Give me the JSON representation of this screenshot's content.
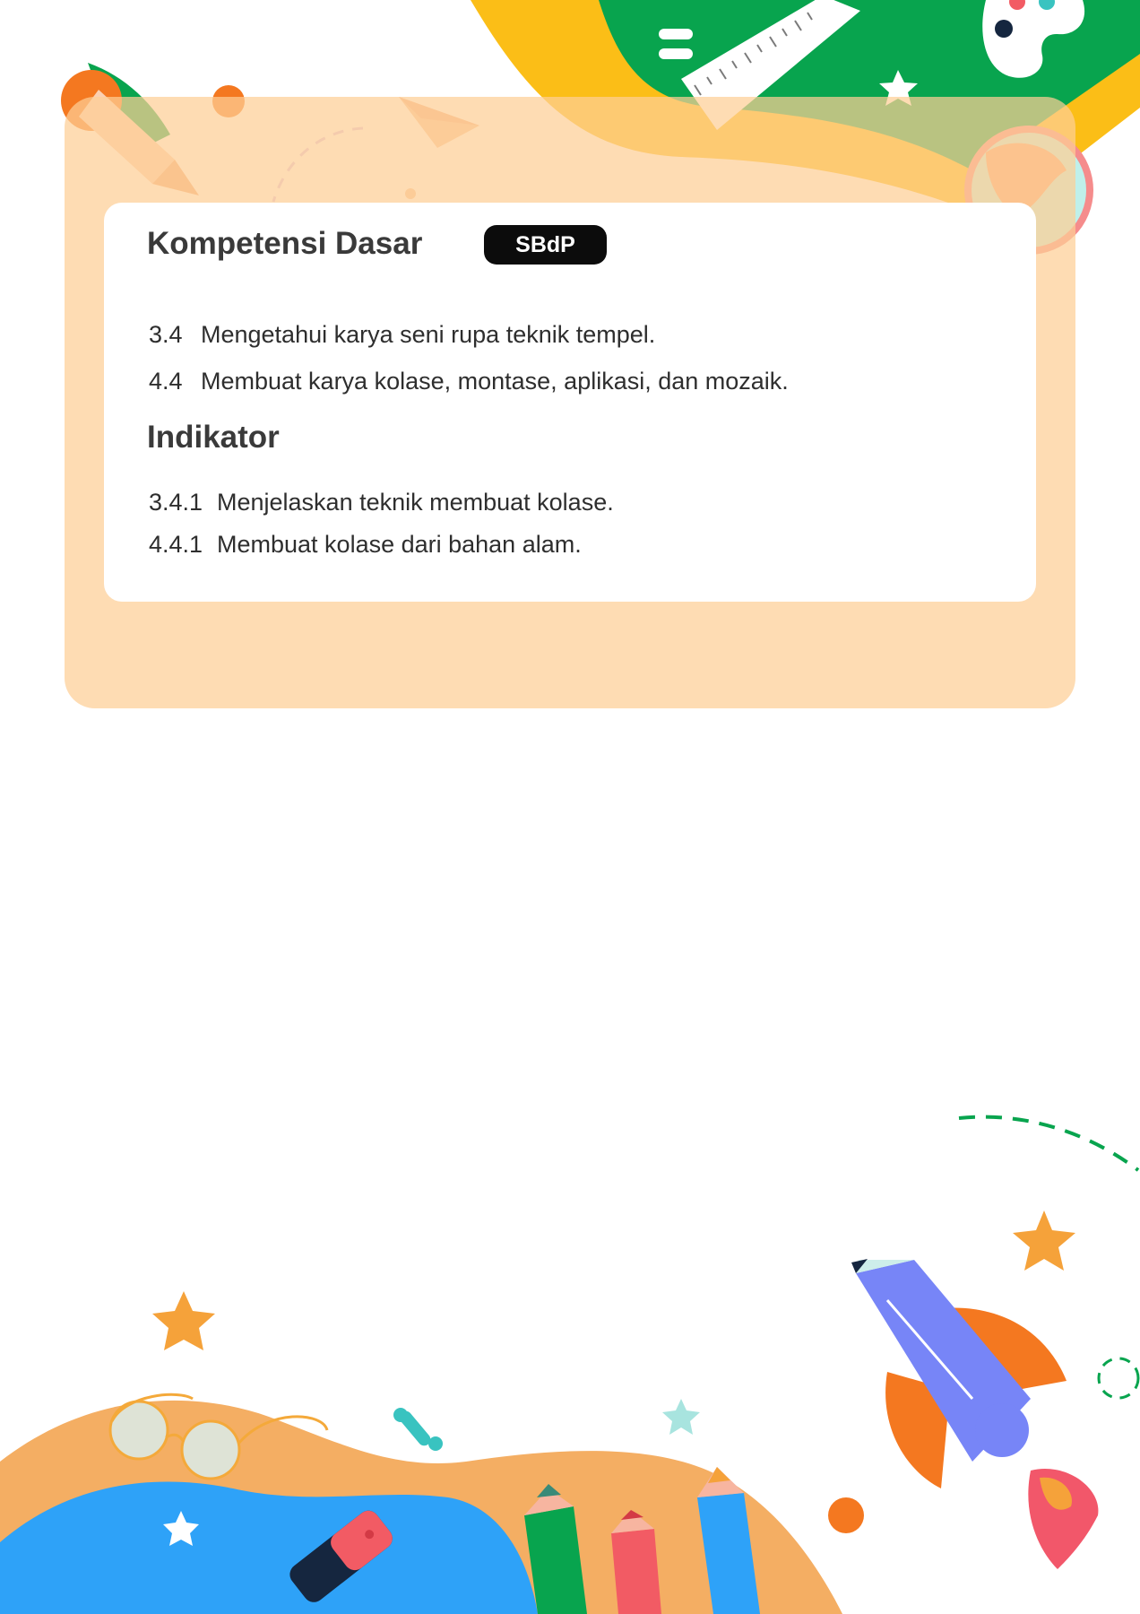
{
  "kompetensi": {
    "title": "Kompetensi Dasar",
    "badge": "SBdP",
    "items": [
      {
        "num": "3.4",
        "text": "Mengetahui karya seni rupa teknik tempel."
      },
      {
        "num": "4.4",
        "text": "Membuat karya kolase, montase, aplikasi, dan mozaik."
      }
    ]
  },
  "indikator": {
    "title": "Indikator",
    "items": [
      {
        "num": "3.4.1",
        "text": "Menjelaskan teknik membuat kolase."
      },
      {
        "num": "4.4.1",
        "text": "Membuat kolase dari bahan alam."
      }
    ]
  },
  "colors": {
    "panel": "#fdcf96",
    "badge": "#0c0c0c",
    "green": "#08a44e",
    "yellow": "#fbbe17",
    "orange": "#f47820",
    "blue": "#2ea2f8",
    "sand": "#f4ae63"
  },
  "icons": [
    "ruler-icon",
    "palette-icon",
    "globe-icon",
    "paper-plane-icon",
    "pencil-icon",
    "star-icon",
    "glasses-icon",
    "eraser-icon",
    "colored-pencils-icon",
    "rocket-pencil-icon",
    "percent-icon"
  ]
}
